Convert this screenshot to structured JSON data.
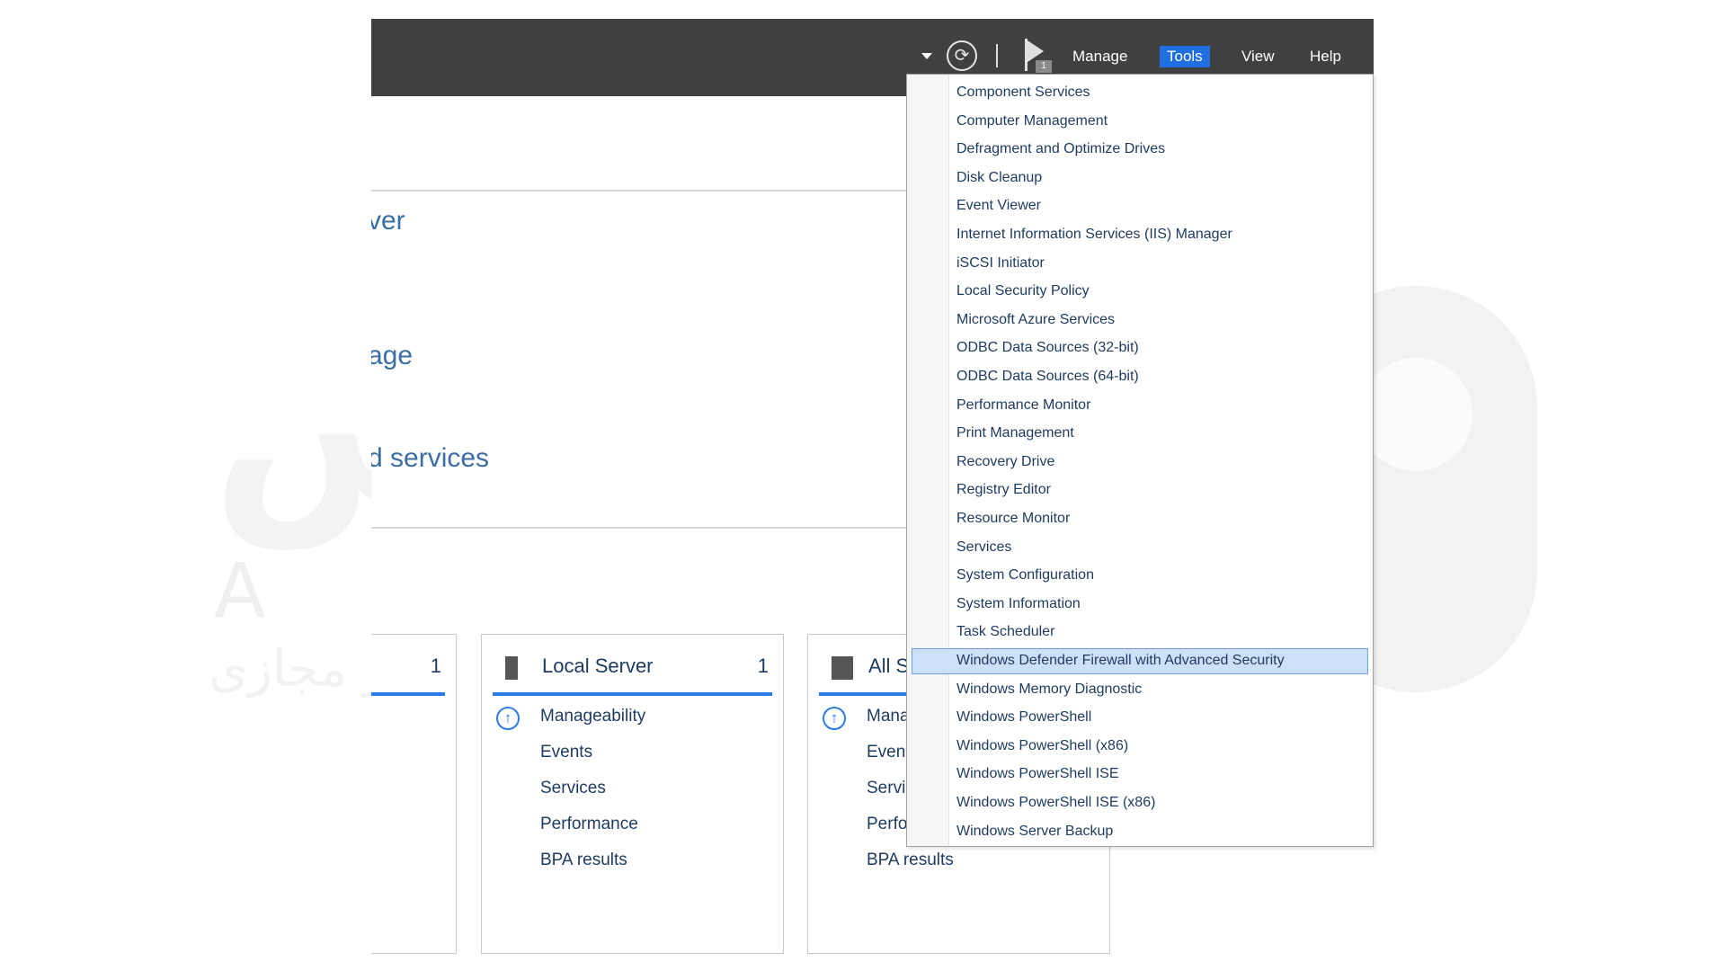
{
  "watermark": {
    "mark": "آذرسیس",
    "letters": "AZARSYS",
    "subtitle": "ســرور و هـاست و سـرور مجازی"
  },
  "titlebar": {
    "refresh_glyph": "⟳",
    "flag_badge": "1",
    "menu": {
      "manage": "Manage",
      "tools": "Tools",
      "view": "View",
      "help": "Help"
    }
  },
  "welcome": {
    "line1": "ver",
    "line2": "age",
    "line3": "d services"
  },
  "tiles": {
    "left": {
      "count": "1"
    },
    "local_server": {
      "title": "Local Server",
      "count": "1",
      "rows": [
        "Manageability",
        "Events",
        "Services",
        "Performance",
        "BPA results"
      ]
    },
    "all_servers": {
      "title": "All S",
      "rows": [
        "Mana",
        "Even",
        "Servi",
        "Perfo",
        "BPA results"
      ]
    }
  },
  "tools_menu": {
    "items": [
      "Component Services",
      "Computer Management",
      "Defragment and Optimize Drives",
      "Disk Cleanup",
      "Event Viewer",
      "Internet Information Services (IIS) Manager",
      "iSCSI Initiator",
      "Local Security Policy",
      "Microsoft Azure Services",
      "ODBC Data Sources (32-bit)",
      "ODBC Data Sources (64-bit)",
      "Performance Monitor",
      "Print Management",
      "Recovery Drive",
      "Registry Editor",
      "Resource Monitor",
      "Services",
      "System Configuration",
      "System Information",
      "Task Scheduler",
      "Windows Defender Firewall with Advanced Security",
      "Windows Memory Diagnostic",
      "Windows PowerShell",
      "Windows PowerShell (x86)",
      "Windows PowerShell ISE",
      "Windows PowerShell ISE (x86)",
      "Windows Server Backup"
    ],
    "selected_item": "Windows Defender Firewall with Advanced Security"
  },
  "colors": {
    "titlebar": "#404040",
    "accent": "#1f6fe0",
    "selection": "#cce0f9"
  }
}
